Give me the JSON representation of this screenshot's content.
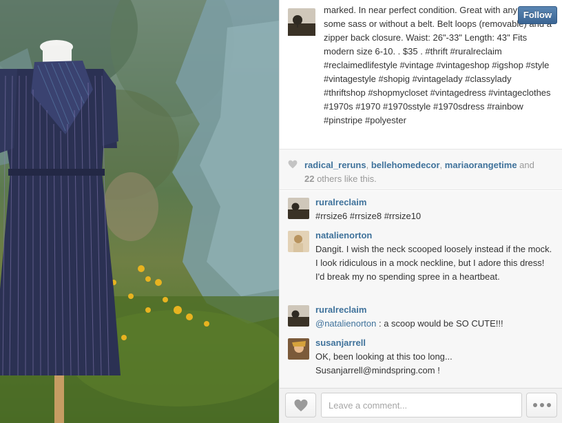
{
  "post": {
    "caption": "marked. In near perfect condition. Great with any color for some sass or without a belt. Belt loops (removable) and a zipper back closure. Waist: 26\"-33\" Length: 43\" Fits modern size 6-10. . $35 . #thrift #ruralreclaim #reclaimedlifestyle #vintage #vintageshop #igshop #style #vintagestyle #shopig #vintagelady #classylady #thriftshop #shopmycloset #vintagedress #vintageclothes #1970s #1970 #1970sstyle #1970sdress #rainbow #pinstripe #polyester",
    "follow_label": "Follow"
  },
  "likes": {
    "users": [
      "radical_reruns",
      "bellehomedecor",
      "mariaorangetime"
    ],
    "sep1": ", ",
    "sep2": ", ",
    "and_text": " and",
    "others_count": "22",
    "others_suffix": " others like this."
  },
  "comments": [
    {
      "user": "ruralreclaim",
      "text": "#rrsize6 #rrsize8 #rrsize10"
    },
    {
      "user": "natalienorton",
      "text": "Dangit. I wish the neck scooped loosely instead if the mock. I look ridiculous in a mock neckline, but I adore this dress! I'd break my no spending spree in a heartbeat."
    },
    {
      "user": "ruralreclaim",
      "mention": "@natalienorton",
      "text": " : a scoop would be SO CUTE!!!"
    },
    {
      "user": "susanjarrell",
      "text": "OK, been looking at this too long... Susanjarrell@mindspring.com !"
    }
  ],
  "footer": {
    "comment_placeholder": "Leave a comment..."
  },
  "colors": {
    "link_blue": "#3f729b",
    "follow_button": "#4b79a7"
  },
  "icons": {
    "like": "heart-icon",
    "more": "more-dots-icon"
  }
}
